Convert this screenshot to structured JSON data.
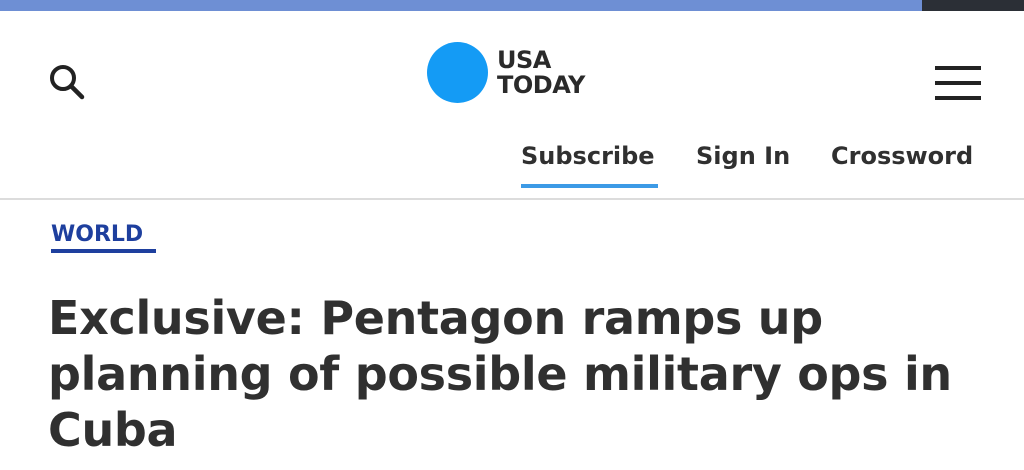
{
  "progress": {
    "fraction": 0.9
  },
  "colors": {
    "brand_blue": "#149bf5",
    "section_blue": "#1e3f9e",
    "subscribe_underline": "#3c9ae6",
    "text_dark": "#303030",
    "progress_bar": "#6e8fd4"
  },
  "header": {
    "search_icon": "search-icon",
    "menu_icon": "hamburger-menu-icon",
    "logo": {
      "line1": "USA",
      "line2": "TODAY"
    },
    "nav": {
      "subscribe": "Subscribe",
      "sign_in": "Sign In",
      "crossword": "Crossword"
    }
  },
  "article": {
    "section": "WORLD",
    "headline": "Exclusive: Pentagon ramps up planning of possible military ops in Cuba"
  }
}
